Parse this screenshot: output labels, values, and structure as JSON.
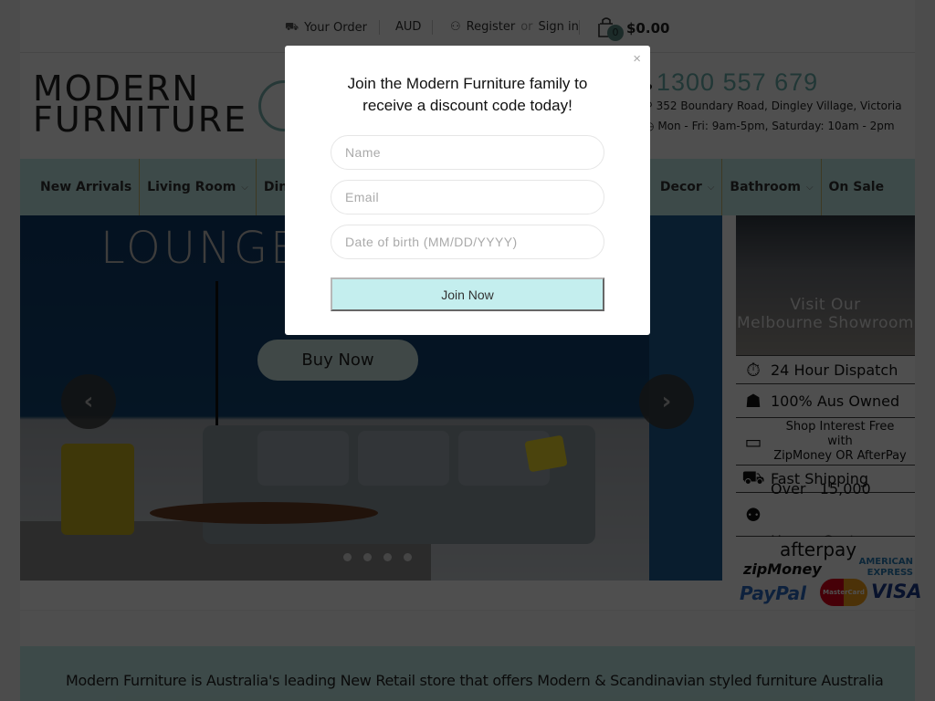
{
  "topbar": {
    "order_label": "Your Order",
    "currency": "AUD",
    "register_label": "Register",
    "or_text": "or",
    "signin_label": "Sign in",
    "cart_count": "0",
    "cart_total": "$0.00"
  },
  "header": {
    "logo_line1": "MODERN",
    "logo_line2": "FURNITURE",
    "phone": "1300 557 679",
    "address": "352 Boundary Road, Dingley Village, Victoria",
    "hours": "Mon - Fri: 9am-5pm, Saturday: 10am - 2pm"
  },
  "nav": {
    "items": [
      {
        "label": "New Arrivals",
        "has_dropdown": false
      },
      {
        "label": "Living Room",
        "has_dropdown": true
      },
      {
        "label": "Dining",
        "has_dropdown": true
      },
      {
        "label": "Decor",
        "has_dropdown": true
      },
      {
        "label": "Bathroom",
        "has_dropdown": true
      },
      {
        "label": "On Sale",
        "has_dropdown": false
      }
    ]
  },
  "hero": {
    "title": "LOUNGE",
    "button_label": "Buy Now",
    "prev_icon": "‹",
    "next_icon": "›",
    "slide_count": 4
  },
  "sidebar": {
    "showroom_line1": "Visit Our",
    "showroom_line2": "Melbourne Showroom",
    "perks": [
      {
        "icon": "stopwatch-icon",
        "label": "24 Hour Dispatch"
      },
      {
        "icon": "australia-icon",
        "label": "100% Aus Owned"
      },
      {
        "icon": "card-hand-icon",
        "label_line1": "Shop Interest Free",
        "label_line2": "with",
        "label_line3": "ZipMoney OR AfterPay"
      },
      {
        "icon": "truck-icon",
        "label": "Fast Shipping"
      },
      {
        "icon": "high-five-icon",
        "label_line1": "Over   15,000",
        "label_line2": "Happy Customers"
      }
    ],
    "payments": [
      "afterpay",
      "zipMoney",
      "AMERICAN EXPRESS",
      "PayPal",
      "MasterCard",
      "VISA"
    ]
  },
  "about": {
    "text": "Modern Furniture is Australia's leading New Retail store that offers Modern & Scandinavian styled furniture Australia"
  },
  "modal": {
    "heading_line1": "Join the Modern Furniture family to",
    "heading_line2": "receive a discount code today!",
    "name_placeholder": "Name",
    "email_placeholder": "Email",
    "dob_placeholder": "Date of birth (MM/DD/YYYY)",
    "name_value": "",
    "email_value": "",
    "dob_value": "",
    "submit_label": "Join Now",
    "close_icon": "×"
  },
  "colors": {
    "accent": "#c6eeea",
    "phone": "#6bb3ad",
    "join_button": "#c4eeee"
  }
}
